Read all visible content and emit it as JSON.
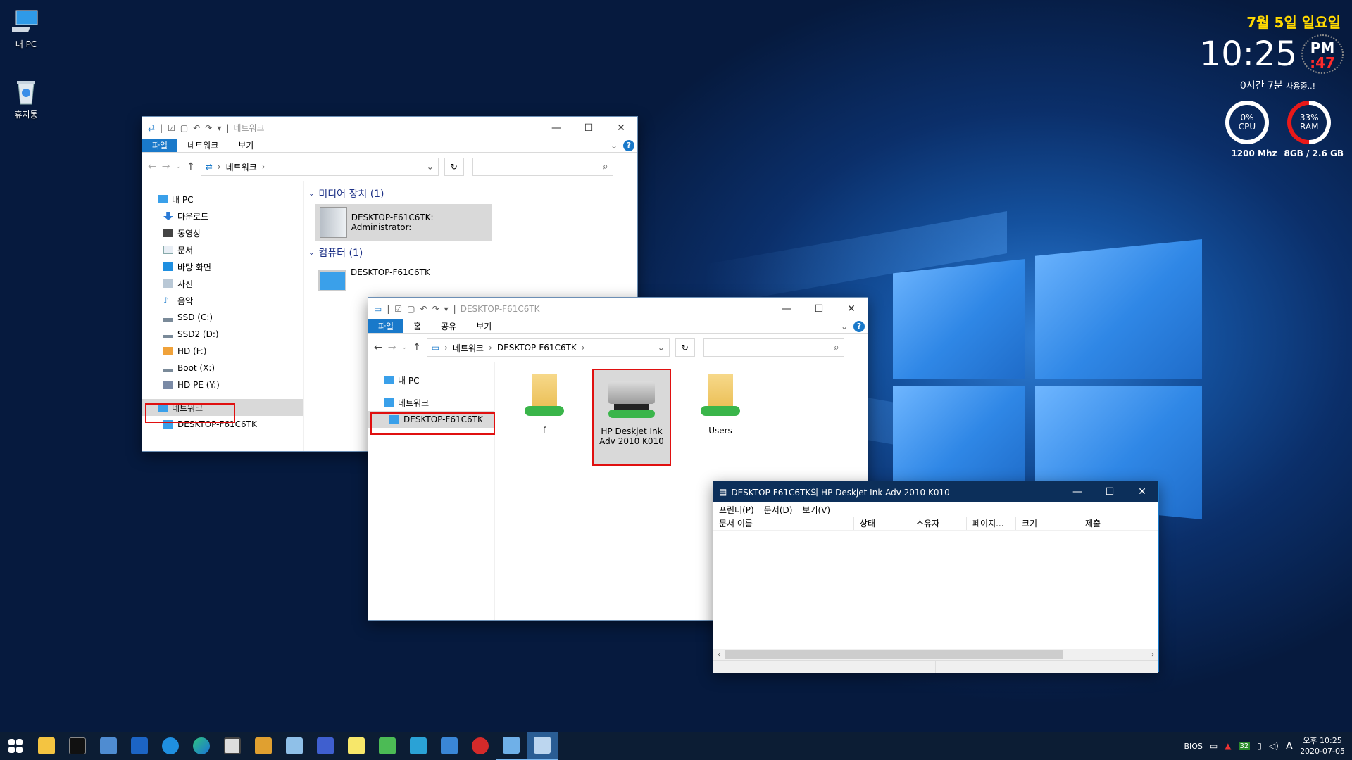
{
  "desktop": {
    "icons": [
      {
        "label": "내 PC"
      },
      {
        "label": "휴지통"
      }
    ]
  },
  "clock_widget": {
    "date": "7월 5일 일요일",
    "time": "10:25",
    "ampm": "PM",
    "seconds": ":47",
    "uptime": "0시간 7분",
    "uptime_suffix": "사용중..!",
    "cpu": {
      "percent": "0%",
      "label": "CPU",
      "freq": "1200 Mhz",
      "level": 0
    },
    "ram": {
      "percent": "33%",
      "label": "RAM",
      "info": "8GB /  2.6 GB",
      "level": 0.33
    }
  },
  "win_network": {
    "title": "네트워크",
    "tabs": [
      "파일",
      "네트워크",
      "보기"
    ],
    "address": "네트워크",
    "nav": [
      "내 PC",
      "다운로드",
      "동영상",
      "문서",
      "바탕 화면",
      "사진",
      "음악",
      "SSD (C:)",
      "SSD2 (D:)",
      "HD (F:)",
      "Boot (X:)",
      "HD PE (Y:)",
      "네트워크",
      "DESKTOP-F61C6TK"
    ],
    "groups": [
      {
        "header": "미디어 장치 (1)",
        "item": "DESKTOP-F61C6TK: Administrator:"
      },
      {
        "header": "컴퓨터 (1)",
        "item": "DESKTOP-F61C6TK"
      }
    ]
  },
  "win_desktop": {
    "title": "DESKTOP-F61C6TK",
    "tabs": [
      "파일",
      "홈",
      "공유",
      "보기"
    ],
    "address": [
      "네트워크",
      "DESKTOP-F61C6TK"
    ],
    "nav": [
      "내 PC",
      "네트워크",
      "DESKTOP-F61C6TK"
    ],
    "items": [
      "f",
      "HP Deskjet Ink Adv 2010 K010",
      "Users"
    ]
  },
  "win_printer": {
    "title": "DESKTOP-F61C6TK의 HP Deskjet Ink Adv 2010 K010",
    "menu": [
      "프린터(P)",
      "문서(D)",
      "보기(V)"
    ],
    "columns": [
      "문서 이름",
      "상태",
      "소유자",
      "페이지...",
      "크기",
      "제출"
    ]
  },
  "tray": {
    "bios": "BIOS",
    "badge": "32",
    "ime": "A",
    "time": "오후 10:25",
    "date": "2020-07-05"
  },
  "colors": {
    "accent": "#1979ca",
    "highlight": "#e01010",
    "taskbar": "#0c1d34",
    "clock_yellow": "#ffd800",
    "seconds_red": "#ff2b2b"
  }
}
